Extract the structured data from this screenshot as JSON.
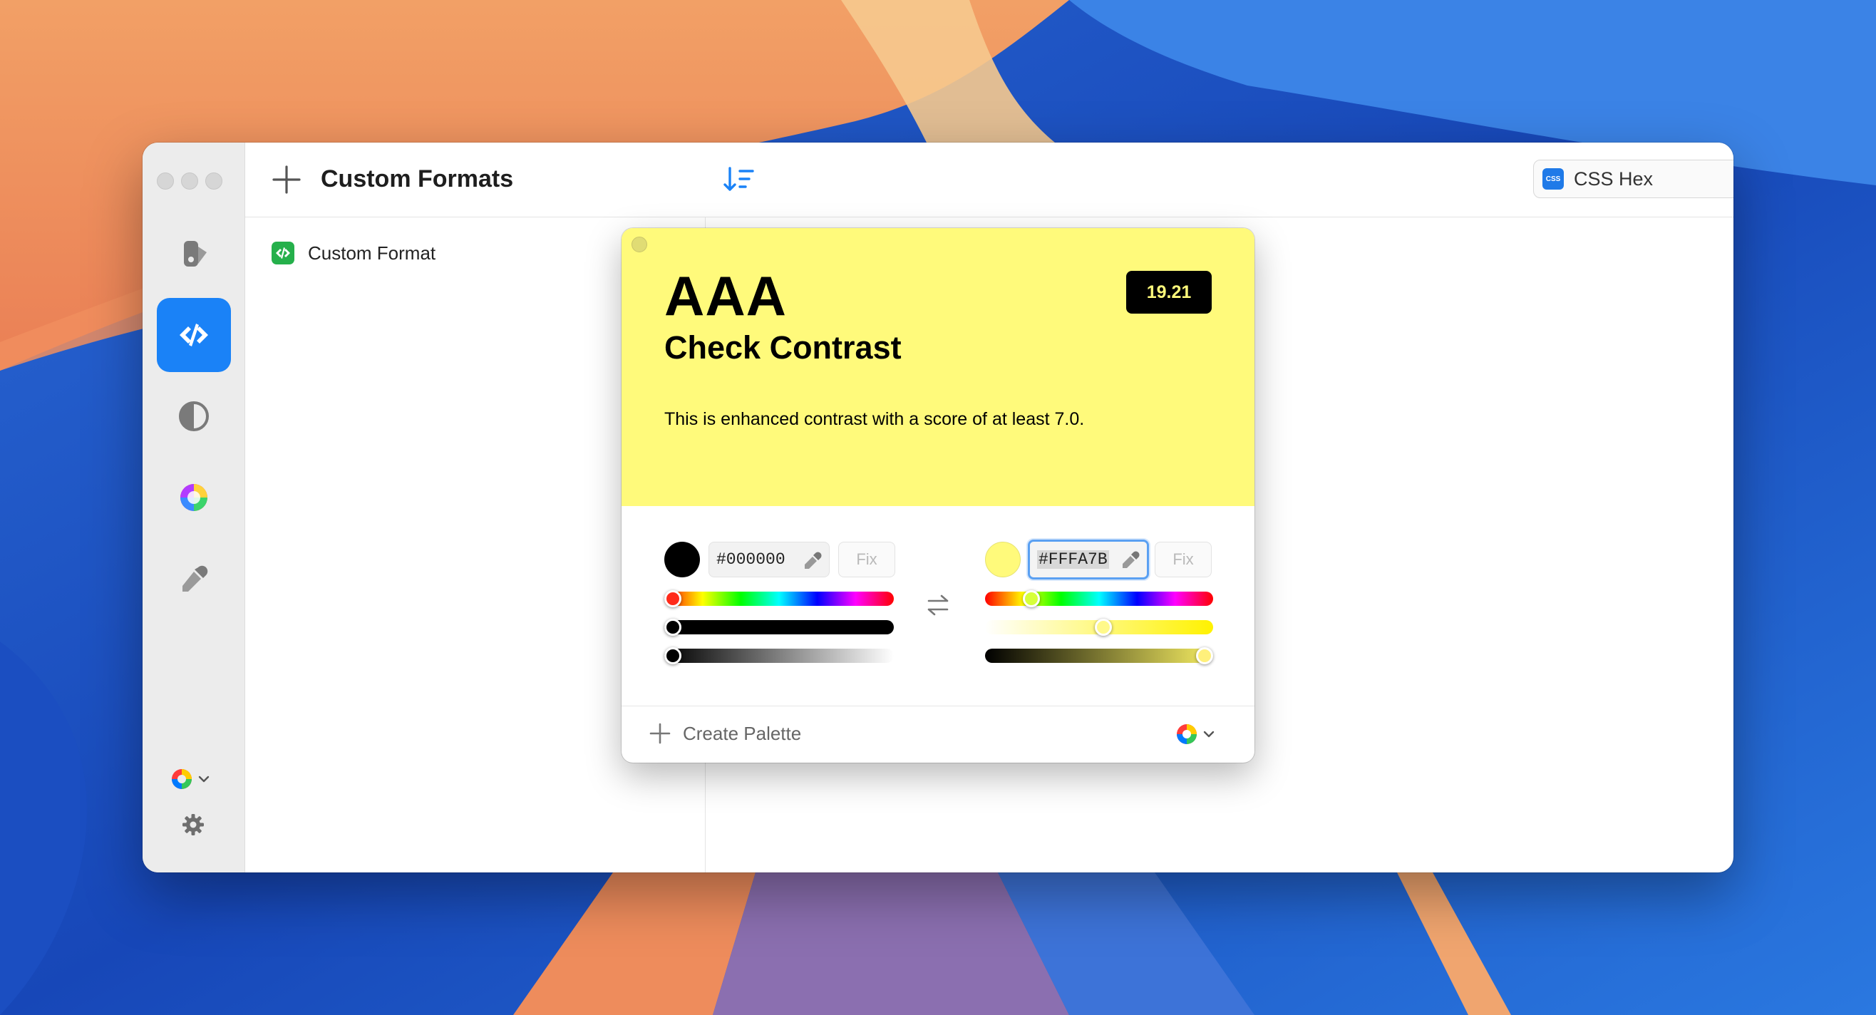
{
  "toolbar": {
    "title": "Custom Formats",
    "format_select": {
      "badge": "CSS",
      "label": "CSS Hex"
    }
  },
  "list": {
    "items": [
      {
        "label": "Custom Format"
      }
    ]
  },
  "contrast": {
    "rating": "AAA",
    "title": "Check Contrast",
    "score": "19.21",
    "description": "This is enhanced contrast with a score of at least 7.0."
  },
  "foreground": {
    "hex": "#000000",
    "fix_label": "Fix",
    "color": "#000000",
    "sliders": {
      "hue": 0.0,
      "saturation": 0.0,
      "brightness": 0.0
    }
  },
  "background": {
    "hex": "#FFFA7B",
    "fix_label": "Fix",
    "color": "#FFFA7B",
    "sliders": {
      "hue": 0.18,
      "saturation": 0.52,
      "brightness": 1.0
    }
  },
  "footer": {
    "create_palette_label": "Create Palette"
  },
  "icons": {
    "sidebar": [
      "contrast-sidebar-icon",
      "custom-formats-icon",
      "contrast-checker-icon",
      "color-wheel-icon",
      "eyedropper-icon"
    ],
    "bottom": [
      "palette-icon",
      "chevron-down-icon",
      "gear-icon"
    ]
  },
  "colors": {
    "accent": "#1A82F7",
    "format_green": "#25B04B"
  }
}
